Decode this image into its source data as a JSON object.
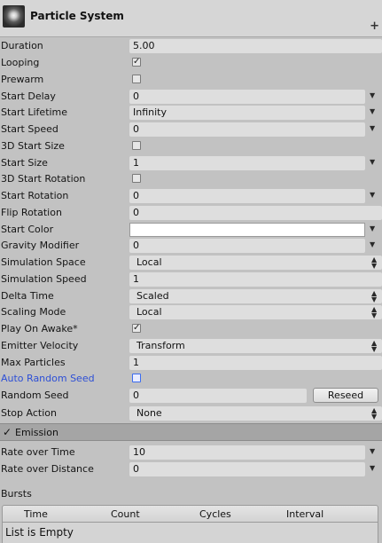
{
  "header": {
    "title": "Particle System",
    "plus": "+"
  },
  "props": {
    "duration": {
      "label": "Duration",
      "value": "5.00"
    },
    "looping": {
      "label": "Looping",
      "check": "✓"
    },
    "prewarm": {
      "label": "Prewarm"
    },
    "start_delay": {
      "label": "Start Delay",
      "value": "0"
    },
    "start_lifetime": {
      "label": "Start Lifetime",
      "value": "Infinity"
    },
    "start_speed": {
      "label": "Start Speed",
      "value": "0"
    },
    "start_size_3d": {
      "label": "3D Start Size"
    },
    "start_size": {
      "label": "Start Size",
      "value": "1"
    },
    "start_rotation_3d": {
      "label": "3D Start Rotation"
    },
    "start_rotation": {
      "label": "Start Rotation",
      "value": "0"
    },
    "flip_rotation": {
      "label": "Flip Rotation",
      "value": "0"
    },
    "start_color": {
      "label": "Start Color",
      "color": "#ffffff"
    },
    "gravity_modifier": {
      "label": "Gravity Modifier",
      "value": "0"
    },
    "simulation_space": {
      "label": "Simulation Space",
      "value": "Local"
    },
    "simulation_speed": {
      "label": "Simulation Speed",
      "value": "1"
    },
    "delta_time": {
      "label": "Delta Time",
      "value": "Scaled"
    },
    "scaling_mode": {
      "label": "Scaling Mode",
      "value": "Local"
    },
    "play_on_awake": {
      "label": "Play On Awake*",
      "check": "✓"
    },
    "emitter_velocity": {
      "label": "Emitter Velocity",
      "value": "Transform"
    },
    "max_particles": {
      "label": "Max Particles",
      "value": "1"
    },
    "auto_random_seed": {
      "label": "Auto Random Seed"
    },
    "random_seed": {
      "label": "Random Seed",
      "value": "0",
      "button": "Reseed"
    },
    "stop_action": {
      "label": "Stop Action",
      "value": "None"
    }
  },
  "emission": {
    "title": "Emission",
    "check": "✓",
    "rate_over_time": {
      "label": "Rate over Time",
      "value": "10"
    },
    "rate_over_distance": {
      "label": "Rate over Distance",
      "value": "0"
    },
    "bursts": {
      "label": "Bursts",
      "columns": [
        "Time",
        "Count",
        "Cycles",
        "Interval"
      ],
      "empty": "List is Empty"
    }
  },
  "glyphs": {
    "arrow": "▼",
    "updown_up": "▲",
    "updown_down": "▼"
  }
}
